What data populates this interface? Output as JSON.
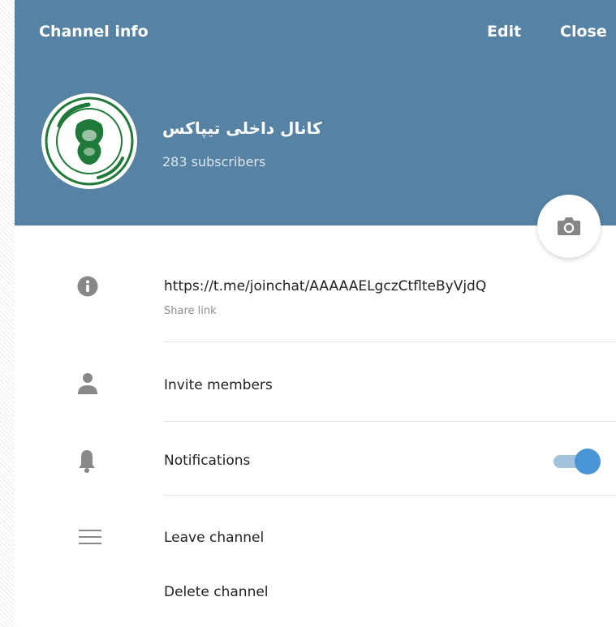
{
  "header": {
    "title": "Channel info",
    "edit_label": "Edit",
    "close_label": "Close",
    "background_color": "#5682a3"
  },
  "channel": {
    "name": "کانال داخلی تیپاکس",
    "subscribers": "283 subscribers",
    "avatar_icon": "tipax-logo"
  },
  "camera_button": {
    "icon": "camera-icon"
  },
  "rows": {
    "link": {
      "value": "https://t.me/joinchat/AAAAAELgczCtflteByVjdQ",
      "caption": "Share link",
      "icon": "info-icon"
    },
    "invite": {
      "label": "Invite members",
      "icon": "person-icon"
    },
    "notifications": {
      "label": "Notifications",
      "icon": "bell-icon",
      "enabled": true,
      "accent_color": "#4a95d6"
    },
    "leave": {
      "label": "Leave channel",
      "icon": "menu-icon"
    },
    "delete": {
      "label": "Delete channel"
    }
  }
}
